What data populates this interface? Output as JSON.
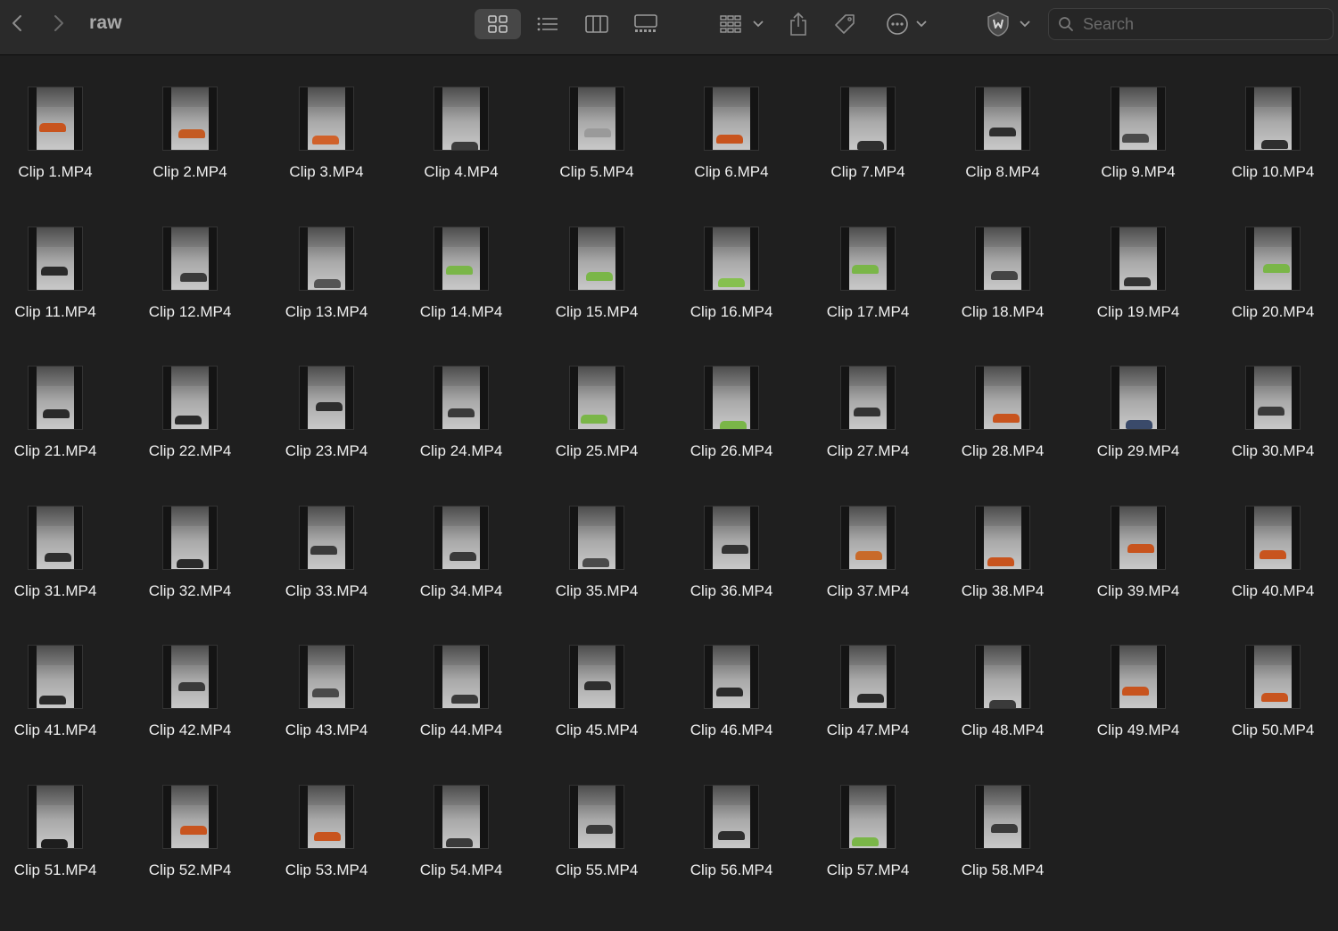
{
  "window": {
    "folder_title": "raw",
    "back_icon": "chevron-left-icon",
    "forward_icon": "chevron-right-icon"
  },
  "toolbar": {
    "view_modes": [
      {
        "name": "icon-view",
        "icon": "grid-icon",
        "active": true
      },
      {
        "name": "list-view",
        "icon": "list-icon",
        "active": false
      },
      {
        "name": "column-view",
        "icon": "columns-icon",
        "active": false
      },
      {
        "name": "gallery-view",
        "icon": "gallery-icon",
        "active": false
      }
    ],
    "group_icon": "group-grid-icon",
    "share_icon": "share-icon",
    "tag_icon": "tag-icon",
    "more_icon": "ellipsis-circle-icon",
    "extension_icon": "shield-extension-icon"
  },
  "search": {
    "placeholder": "Search",
    "value": ""
  },
  "files": [
    {
      "name": "Clip 1.MP4",
      "car": "#c8541e"
    },
    {
      "name": "Clip 2.MP4",
      "car": "#c45a22"
    },
    {
      "name": "Clip 3.MP4",
      "car": "#d0612a"
    },
    {
      "name": "Clip 4.MP4",
      "car": "#3c3c3c"
    },
    {
      "name": "Clip 5.MP4",
      "car": "#9a9a9a"
    },
    {
      "name": "Clip 6.MP4",
      "car": "#c8541e"
    },
    {
      "name": "Clip 7.MP4",
      "car": "#2e2e2e"
    },
    {
      "name": "Clip 8.MP4",
      "car": "#2e2e2e"
    },
    {
      "name": "Clip 9.MP4",
      "car": "#4a4a4a"
    },
    {
      "name": "Clip 10.MP4",
      "car": "#2e2e2e"
    },
    {
      "name": "Clip 11.MP4",
      "car": "#2a2a2a"
    },
    {
      "name": "Clip 12.MP4",
      "car": "#3a3a3a"
    },
    {
      "name": "Clip 13.MP4",
      "car": "#555555"
    },
    {
      "name": "Clip 14.MP4",
      "car": "#7ab648"
    },
    {
      "name": "Clip 15.MP4",
      "car": "#7ab648"
    },
    {
      "name": "Clip 16.MP4",
      "car": "#86c04f"
    },
    {
      "name": "Clip 17.MP4",
      "car": "#7ab648"
    },
    {
      "name": "Clip 18.MP4",
      "car": "#444444"
    },
    {
      "name": "Clip 19.MP4",
      "car": "#333333"
    },
    {
      "name": "Clip 20.MP4",
      "car": "#7ab648"
    },
    {
      "name": "Clip 21.MP4",
      "car": "#2a2a2a"
    },
    {
      "name": "Clip 22.MP4",
      "car": "#2a2a2a"
    },
    {
      "name": "Clip 23.MP4",
      "car": "#2e2e2e"
    },
    {
      "name": "Clip 24.MP4",
      "car": "#3a3a3a"
    },
    {
      "name": "Clip 25.MP4",
      "car": "#7ab648"
    },
    {
      "name": "Clip 26.MP4",
      "car": "#7ab648"
    },
    {
      "name": "Clip 27.MP4",
      "car": "#333333"
    },
    {
      "name": "Clip 28.MP4",
      "car": "#c8541e"
    },
    {
      "name": "Clip 29.MP4",
      "car": "#3a4a6a"
    },
    {
      "name": "Clip 30.MP4",
      "car": "#3a3a3a"
    },
    {
      "name": "Clip 31.MP4",
      "car": "#2e2e2e"
    },
    {
      "name": "Clip 32.MP4",
      "car": "#2a2a2a"
    },
    {
      "name": "Clip 33.MP4",
      "car": "#3a3a3a"
    },
    {
      "name": "Clip 34.MP4",
      "car": "#3a3a3a"
    },
    {
      "name": "Clip 35.MP4",
      "car": "#4a4a4a"
    },
    {
      "name": "Clip 36.MP4",
      "car": "#333333"
    },
    {
      "name": "Clip 37.MP4",
      "car": "#c86a2a"
    },
    {
      "name": "Clip 38.MP4",
      "car": "#c8541e"
    },
    {
      "name": "Clip 39.MP4",
      "car": "#c8541e"
    },
    {
      "name": "Clip 40.MP4",
      "car": "#c8541e"
    },
    {
      "name": "Clip 41.MP4",
      "car": "#2a2a2a"
    },
    {
      "name": "Clip 42.MP4",
      "car": "#3a3a3a"
    },
    {
      "name": "Clip 43.MP4",
      "car": "#4a4a4a"
    },
    {
      "name": "Clip 44.MP4",
      "car": "#3a3a3a"
    },
    {
      "name": "Clip 45.MP4",
      "car": "#2e2e2e"
    },
    {
      "name": "Clip 46.MP4",
      "car": "#2a2a2a"
    },
    {
      "name": "Clip 47.MP4",
      "car": "#2a2a2a"
    },
    {
      "name": "Clip 48.MP4",
      "car": "#3a3a3a"
    },
    {
      "name": "Clip 49.MP4",
      "car": "#c8541e"
    },
    {
      "name": "Clip 50.MP4",
      "car": "#c8541e"
    },
    {
      "name": "Clip 51.MP4",
      "car": "#1e1e1e"
    },
    {
      "name": "Clip 52.MP4",
      "car": "#c8541e"
    },
    {
      "name": "Clip 53.MP4",
      "car": "#c8541e"
    },
    {
      "name": "Clip 54.MP4",
      "car": "#3a3a3a"
    },
    {
      "name": "Clip 55.MP4",
      "car": "#3a3a3a"
    },
    {
      "name": "Clip 56.MP4",
      "car": "#2e2e2e"
    },
    {
      "name": "Clip 57.MP4",
      "car": "#7ab648"
    },
    {
      "name": "Clip 58.MP4",
      "car": "#3a3a3a"
    }
  ]
}
